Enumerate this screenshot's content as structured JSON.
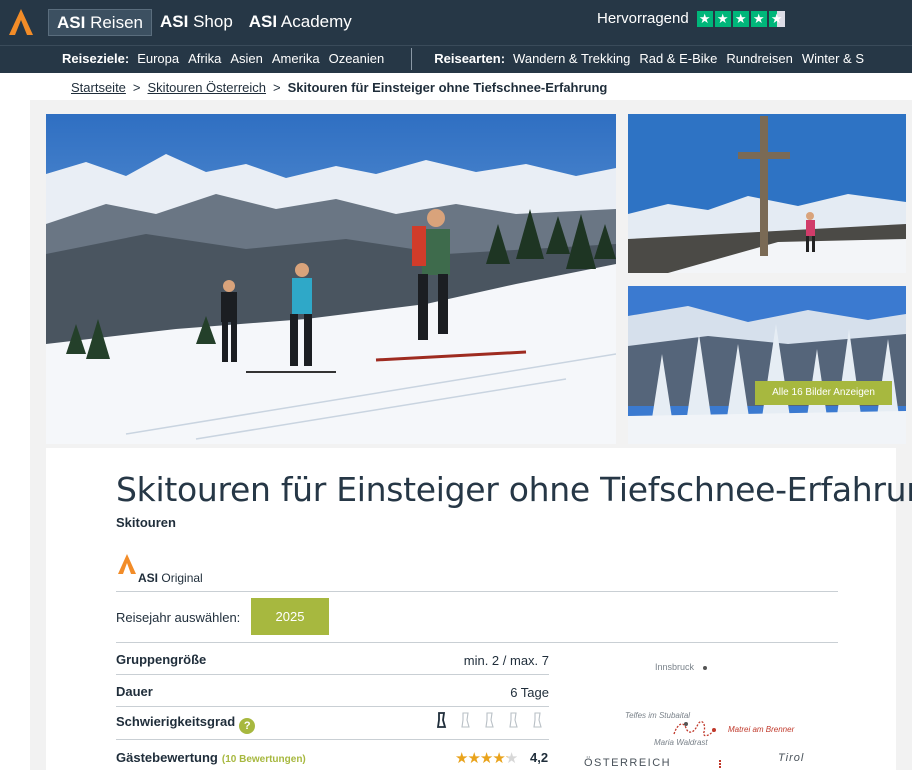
{
  "header": {
    "tabs": [
      {
        "bold": "ASI",
        "rest": "Reisen"
      },
      {
        "bold": "ASI",
        "rest": "Shop"
      },
      {
        "bold": "ASI",
        "rest": "Academy"
      }
    ],
    "rating_text": "Hervorragend",
    "rating_stars": 4.5,
    "brand_color": "#263746",
    "accent_color": "#a7b83f",
    "trustpilot_color": "#00b67a"
  },
  "nav": {
    "destinations_label": "Reiseziele:",
    "destinations": [
      "Europa",
      "Afrika",
      "Asien",
      "Amerika",
      "Ozeanien"
    ],
    "types_label": "Reisearten:",
    "types": [
      "Wandern & Trekking",
      "Rad & E-Bike",
      "Rundreisen",
      "Winter & S"
    ]
  },
  "breadcrumb": {
    "items": [
      "Startseite",
      "Skitouren Österreich"
    ],
    "current": "Skitouren für Einsteiger ohne Tiefschnee-Erfahrung"
  },
  "gallery": {
    "all_images_label": "Alle 16 Bilder Anzeigen"
  },
  "tour": {
    "title": "Skitouren für Einsteiger ohne Tiefschnee-Erfahrung",
    "category": "Skitouren",
    "original_bold": "ASI",
    "original_rest": "Original",
    "year_label": "Reisejahr auswählen:",
    "year_value": "2025",
    "facts": {
      "group_label": "Gruppengröße",
      "group_value": "min. 2 / max. 7",
      "duration_label": "Dauer",
      "duration_value": "6 Tage",
      "difficulty_label": "Schwierigkeitsgrad",
      "difficulty_help": "?",
      "difficulty_level": 1,
      "difficulty_max": 5,
      "rating_label": "Gästebewertung",
      "rating_count": "(10 Bewertungen)",
      "rating_score": "4,2",
      "rating_stars": 4.2
    }
  },
  "map": {
    "innsbruck": "Innsbruck",
    "telfes": "Telfes im Stubaital",
    "maria_waldrast": "Maria Waldrast",
    "matrei": "Matrei am Brenner",
    "country": "ÖSTERREICH",
    "region": "Tirol"
  }
}
